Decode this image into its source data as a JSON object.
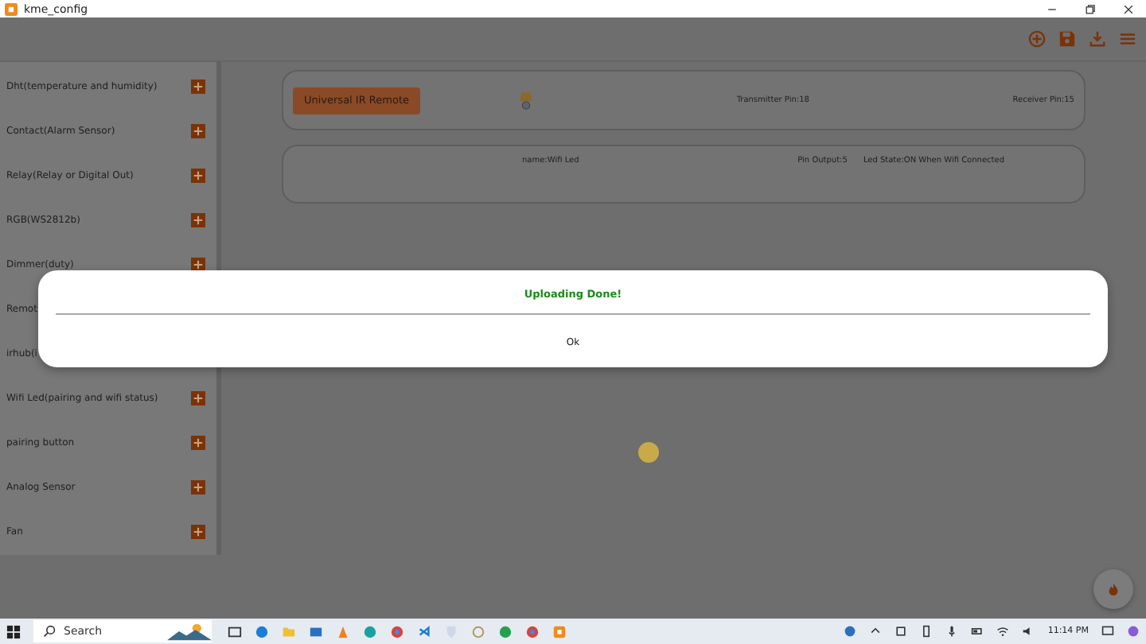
{
  "window": {
    "title": "kme_config"
  },
  "sidebar": {
    "items": [
      {
        "label": "Dht(temperature and humidity)",
        "kind": "add"
      },
      {
        "label": "Contact(Alarm Sensor)",
        "kind": "add"
      },
      {
        "label": "Relay(Relay or Digital Out)",
        "kind": "add"
      },
      {
        "label": "RGB(WS2812b)",
        "kind": "add"
      },
      {
        "label": "Dimmer(duty)",
        "kind": "add"
      },
      {
        "label": "Remot",
        "kind": "covered"
      },
      {
        "label": "irhub(i",
        "kind": "covered"
      },
      {
        "label": "Wifi Led(pairing and wifi status)",
        "kind": "add"
      },
      {
        "label": "pairing button",
        "kind": "add"
      },
      {
        "label": "Analog Sensor",
        "kind": "add"
      },
      {
        "label": "Fan",
        "kind": "add"
      }
    ]
  },
  "cards": [
    {
      "kind": "ir",
      "button": "Universal IR Remote",
      "fields": [
        "Transmitter Pin:18",
        "Receiver Pin:15"
      ]
    },
    {
      "kind": "led",
      "fields": [
        "name:Wifi Led",
        "Pin Output:5",
        "Led State:ON When Wifi Connected"
      ]
    }
  ],
  "dialog": {
    "message": "Uploading Done!",
    "button": "Ok"
  },
  "taskbar": {
    "search_placeholder": "Search",
    "time": "11:14 PM"
  }
}
